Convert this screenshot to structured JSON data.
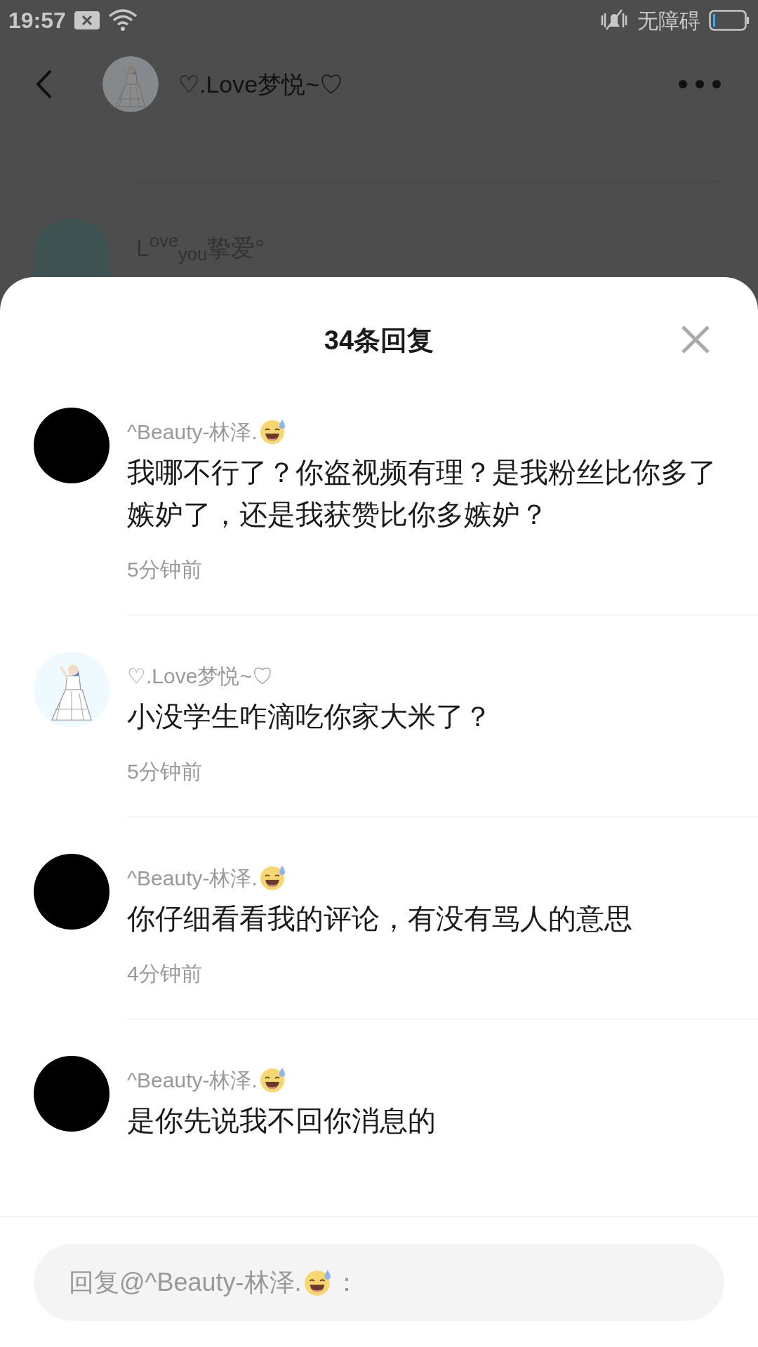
{
  "status_bar": {
    "time": "19:57",
    "accessibility": "无障碍"
  },
  "header": {
    "title": "♡.Love梦悦~♡"
  },
  "background_comment": {
    "author": "L$^{ove}$$_{you}$挚爱°"
  },
  "sheet": {
    "title": "34条回复",
    "comments": [
      {
        "author": "^Beauty-林泽.",
        "kind": "black",
        "text": "我哪不行了？你盗视频有理？是我粉丝比你多了嫉妒了，还是我获赞比你多嫉妒？",
        "time": "5分钟前"
      },
      {
        "author": "♡.Love梦悦~♡",
        "kind": "picture",
        "text": "小没学生咋滴吃你家大米了？",
        "time": "5分钟前"
      },
      {
        "author": "^Beauty-林泽.",
        "kind": "black",
        "text": "你仔细看看我的评论，有没有骂人的意思",
        "time": "4分钟前"
      },
      {
        "author": "^Beauty-林泽.",
        "kind": "black",
        "text": "是你先说我不回你消息的"
      }
    ]
  },
  "reply_box": {
    "placeholder_before": "回复@^Beauty-林泽.",
    "placeholder_after": "："
  }
}
